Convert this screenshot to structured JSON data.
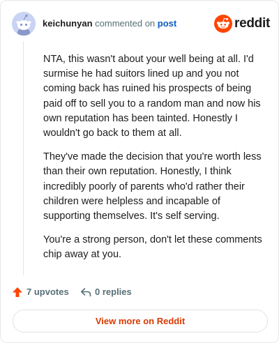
{
  "header": {
    "username": "keichunyan",
    "action_text": "commented on",
    "post_link": "post",
    "brand": "reddit"
  },
  "comment": {
    "paragraphs": [
      "NTA, this wasn't about your well being at all. I'd surmise he had suitors lined up and you not coming back has ruined his prospects of being paid off to sell you to a random man and now his own reputation has been tainted. Honestly I wouldn't go back to them at all.",
      "They've made the decision that you're worth less than their own reputation. Honestly, I think incredibly poorly of parents who'd rather their children were helpless and incapable of supporting themselves. It's self serving.",
      "You're a strong person, don't let these comments chip away at you."
    ]
  },
  "actions": {
    "upvotes": "7 upvotes",
    "replies": "0 replies"
  },
  "footer": {
    "view_more": "View more on Reddit"
  },
  "colors": {
    "brand_orange": "#ff4500",
    "link_blue": "#0b5ac2",
    "view_more_text": "#d93a00",
    "meta_gray": "#576f76"
  }
}
